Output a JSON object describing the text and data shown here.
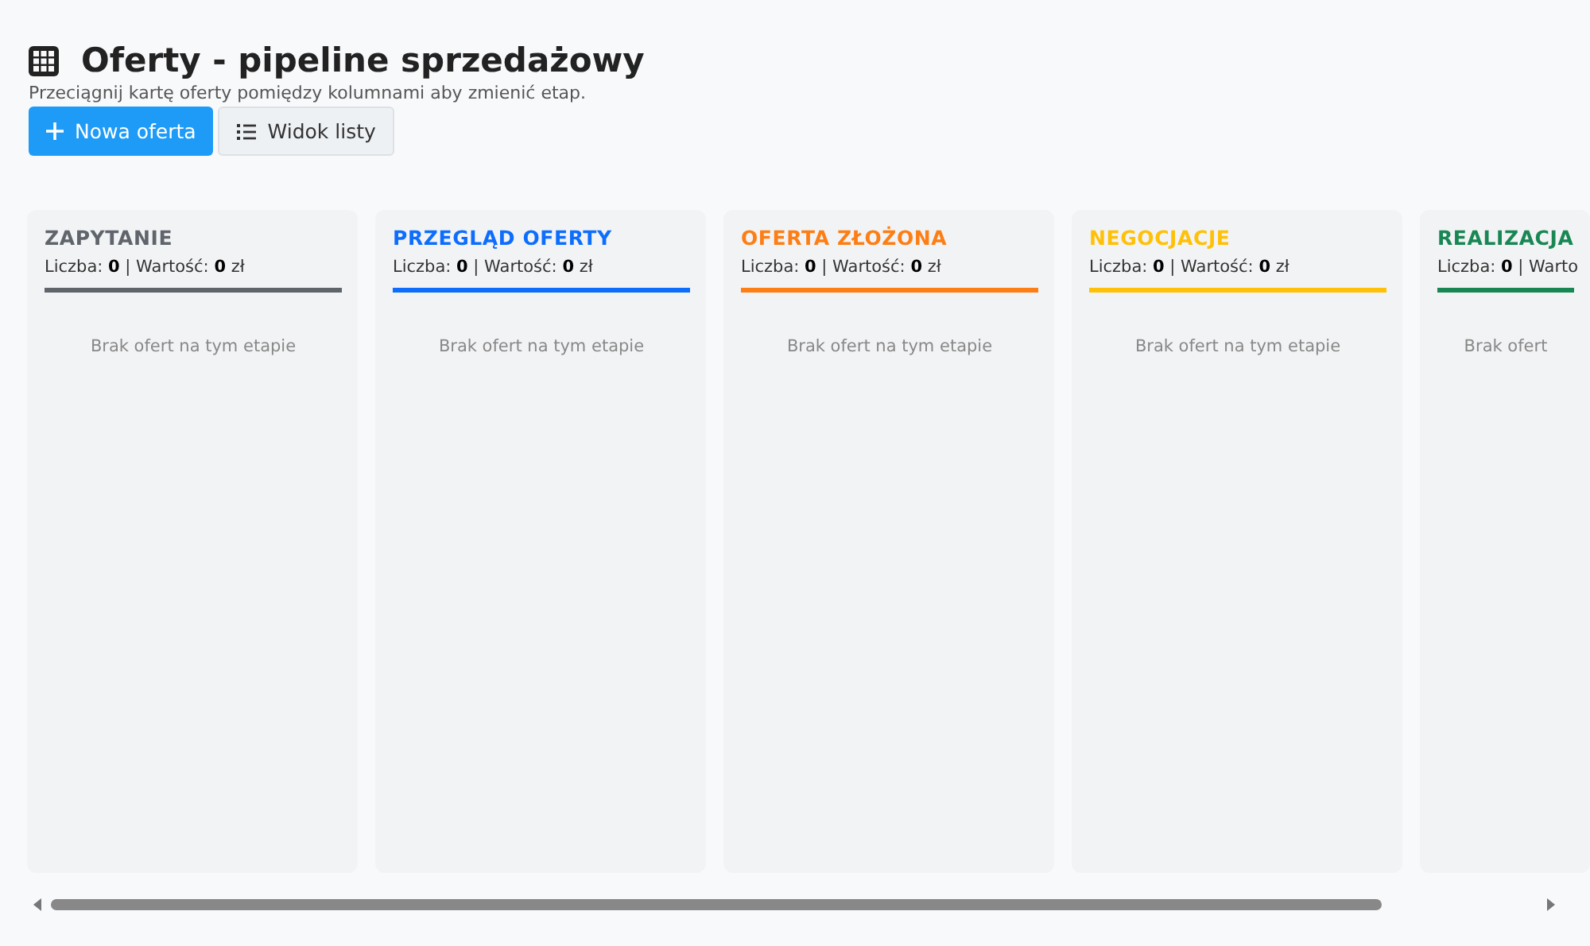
{
  "header": {
    "title": "Oferty - pipeline sprzedażowy",
    "subtitle": "Przeciągnij kartę oferty pomiędzy kolumnami aby zmienić etap."
  },
  "buttons": [
    {
      "kind": "primary",
      "label": "Nowa oferta"
    },
    {
      "kind": "secondary",
      "label": "Widok listy"
    }
  ],
  "columns": [
    {
      "title": "ZAPYTANIE",
      "color": "#5f656b",
      "stats": "Liczba: **0** | Wartość: **0** zł",
      "empty": "Brak ofert na tym etapie"
    },
    {
      "title": "PRZEGLĄD OFERTY",
      "color": "#0d6efd",
      "stats": "Liczba: **0** | Wartość: **0** zł",
      "empty": "Brak ofert na tym etapie"
    },
    {
      "title": "OFERTA ZŁOŻONA",
      "color": "#fd7e14",
      "stats": "Liczba: **0** | Wartość: **0** zł",
      "empty": "Brak ofert na tym etapie"
    },
    {
      "title": "NEGOCJACJE",
      "color": "#ffc107",
      "stats": "Liczba: **0** | Wartość: **0** zł",
      "empty": "Brak ofert na tym etapie"
    },
    {
      "title": "REALIZACJA",
      "color": "#198754",
      "stats": "Liczba: **0** | Warto",
      "empty": "Brak ofert"
    }
  ]
}
